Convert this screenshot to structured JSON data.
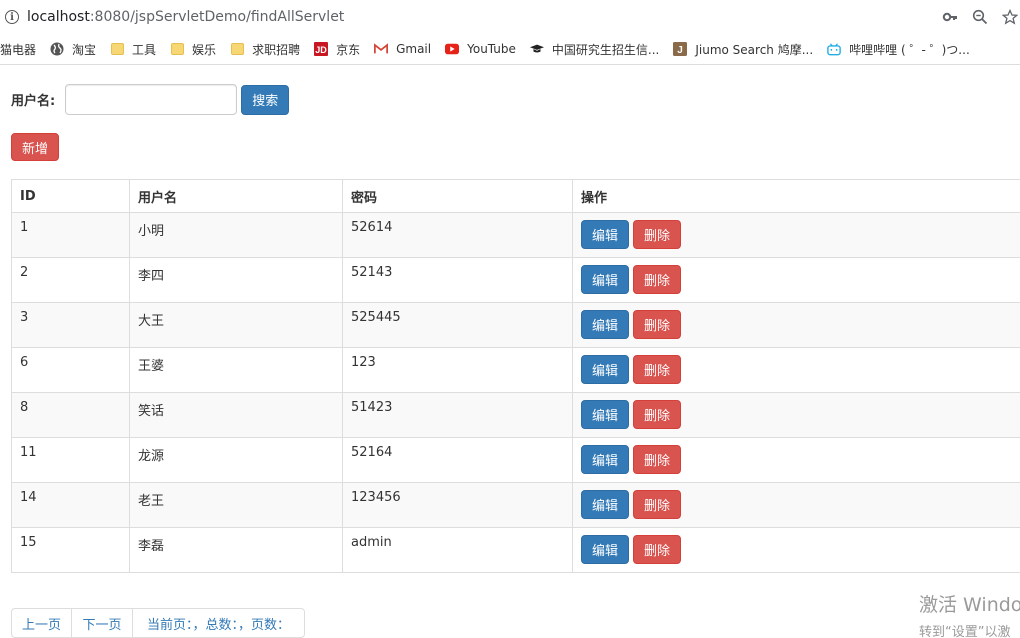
{
  "browser": {
    "url_host": "localhost",
    "url_path": ":8080/jspServletDemo/findAllServlet",
    "bookmarks": [
      {
        "label": "猫电器",
        "icon": "none"
      },
      {
        "label": "淘宝",
        "icon": "globe-icon"
      },
      {
        "label": "工具",
        "icon": "folder-icon"
      },
      {
        "label": "娱乐",
        "icon": "folder-icon"
      },
      {
        "label": "求职招聘",
        "icon": "folder-icon"
      },
      {
        "label": "京东",
        "icon": "jd-icon"
      },
      {
        "label": "Gmail",
        "icon": "gmail-icon"
      },
      {
        "label": "YouTube",
        "icon": "youtube-icon"
      },
      {
        "label": "中国研究生招生信...",
        "icon": "graduation-cap-icon"
      },
      {
        "label": "Jiumo Search 鸠摩...",
        "icon": "jiumo-icon"
      },
      {
        "label": "哔哩哔哩 ( ゜- ゜)つ...",
        "icon": "bilibili-icon"
      }
    ]
  },
  "search": {
    "label": "用户名:",
    "value": "",
    "button_label": "搜索"
  },
  "add_button_label": "新增",
  "table": {
    "headers": [
      "ID",
      "用户名",
      "密码",
      "操作"
    ],
    "rows": [
      {
        "id": "1",
        "username": "小明",
        "password": "52614"
      },
      {
        "id": "2",
        "username": "李四",
        "password": "52143"
      },
      {
        "id": "3",
        "username": "大王",
        "password": "525445"
      },
      {
        "id": "6",
        "username": "王婆",
        "password": "123"
      },
      {
        "id": "8",
        "username": "笑话",
        "password": "51423"
      },
      {
        "id": "11",
        "username": "龙源",
        "password": "52164"
      },
      {
        "id": "14",
        "username": "老王",
        "password": "123456"
      },
      {
        "id": "15",
        "username": "李磊",
        "password": "admin"
      }
    ],
    "edit_label": "编辑",
    "delete_label": "删除"
  },
  "pager": {
    "prev_label": "上一页",
    "next_label": "下一页",
    "info_label": "当前页：，总数：，页数："
  },
  "watermark": {
    "line1": "激活 Windo",
    "line2": "转到“设置”以激"
  },
  "colors": {
    "primary": "#337ab7",
    "danger": "#d9534f",
    "stripe": "#f9f9f9",
    "border": "#dddddd"
  }
}
